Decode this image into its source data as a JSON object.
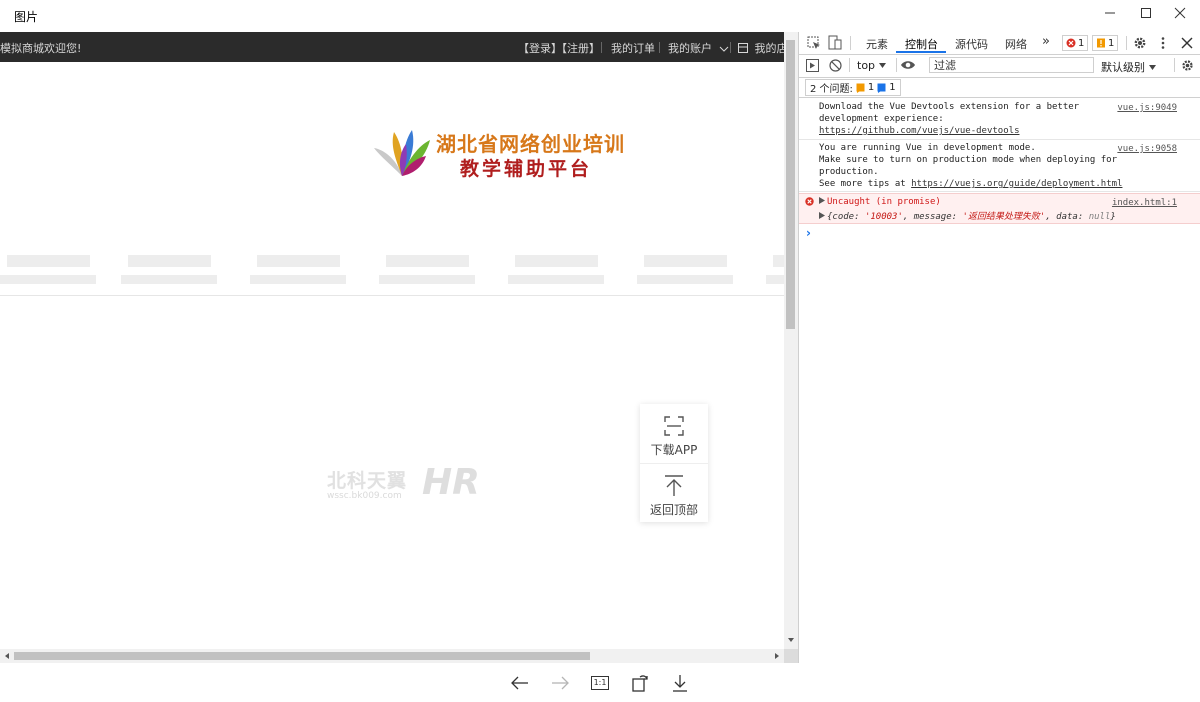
{
  "window": {
    "title": "图片"
  },
  "site": {
    "welcome": "模拟商城欢迎您!",
    "nav": {
      "login": "【登录】",
      "register": "【注册】",
      "my_orders": "我的订单",
      "my_account": "我的账户",
      "my_store": "我的店"
    },
    "logo": {
      "line1": "湖北省网络创业培训",
      "line2": "教学辅助平台"
    },
    "watermark": {
      "text": "北科天翼",
      "sub": "wssc.bk009.com",
      "mark": "HR"
    },
    "float": {
      "download_app": "下载APP",
      "back_to_top": "返回顶部"
    }
  },
  "devtools": {
    "tabs": [
      "元素",
      "控制台",
      "源代码",
      "网络"
    ],
    "active_tab": "控制台",
    "more": "»",
    "error_count": "1",
    "warning_count": "1",
    "context": "top",
    "filter_placeholder": "过滤",
    "level": "默认级别",
    "issues_label": "2 个问题:",
    "issues_warn": "1",
    "issues_info": "1",
    "messages": [
      {
        "lines": [
          "Download the Vue Devtools extension for a better",
          "development experience:",
          "https://github.com/vuejs/vue-devtools"
        ],
        "source": "vue.js:9049"
      },
      {
        "lines": [
          "You are running Vue in development mode.",
          "Make sure to turn on production mode when deploying for",
          "production.",
          "See more tips at "
        ],
        "link": "https://vuejs.org/guide/deployment.html",
        "source": "vue.js:9058"
      }
    ],
    "error": {
      "title": "Uncaught (in promise)",
      "source": "index.html:1",
      "obj_open": "{code: ",
      "code": "'10003'",
      "msg_key": ", message: ",
      "message": "'返回结果处理失败'",
      "data_key": ", data: ",
      "data": "null",
      "obj_close": "}"
    },
    "prompt": "›"
  },
  "viewer": {
    "zoom_label": "1:1"
  }
}
